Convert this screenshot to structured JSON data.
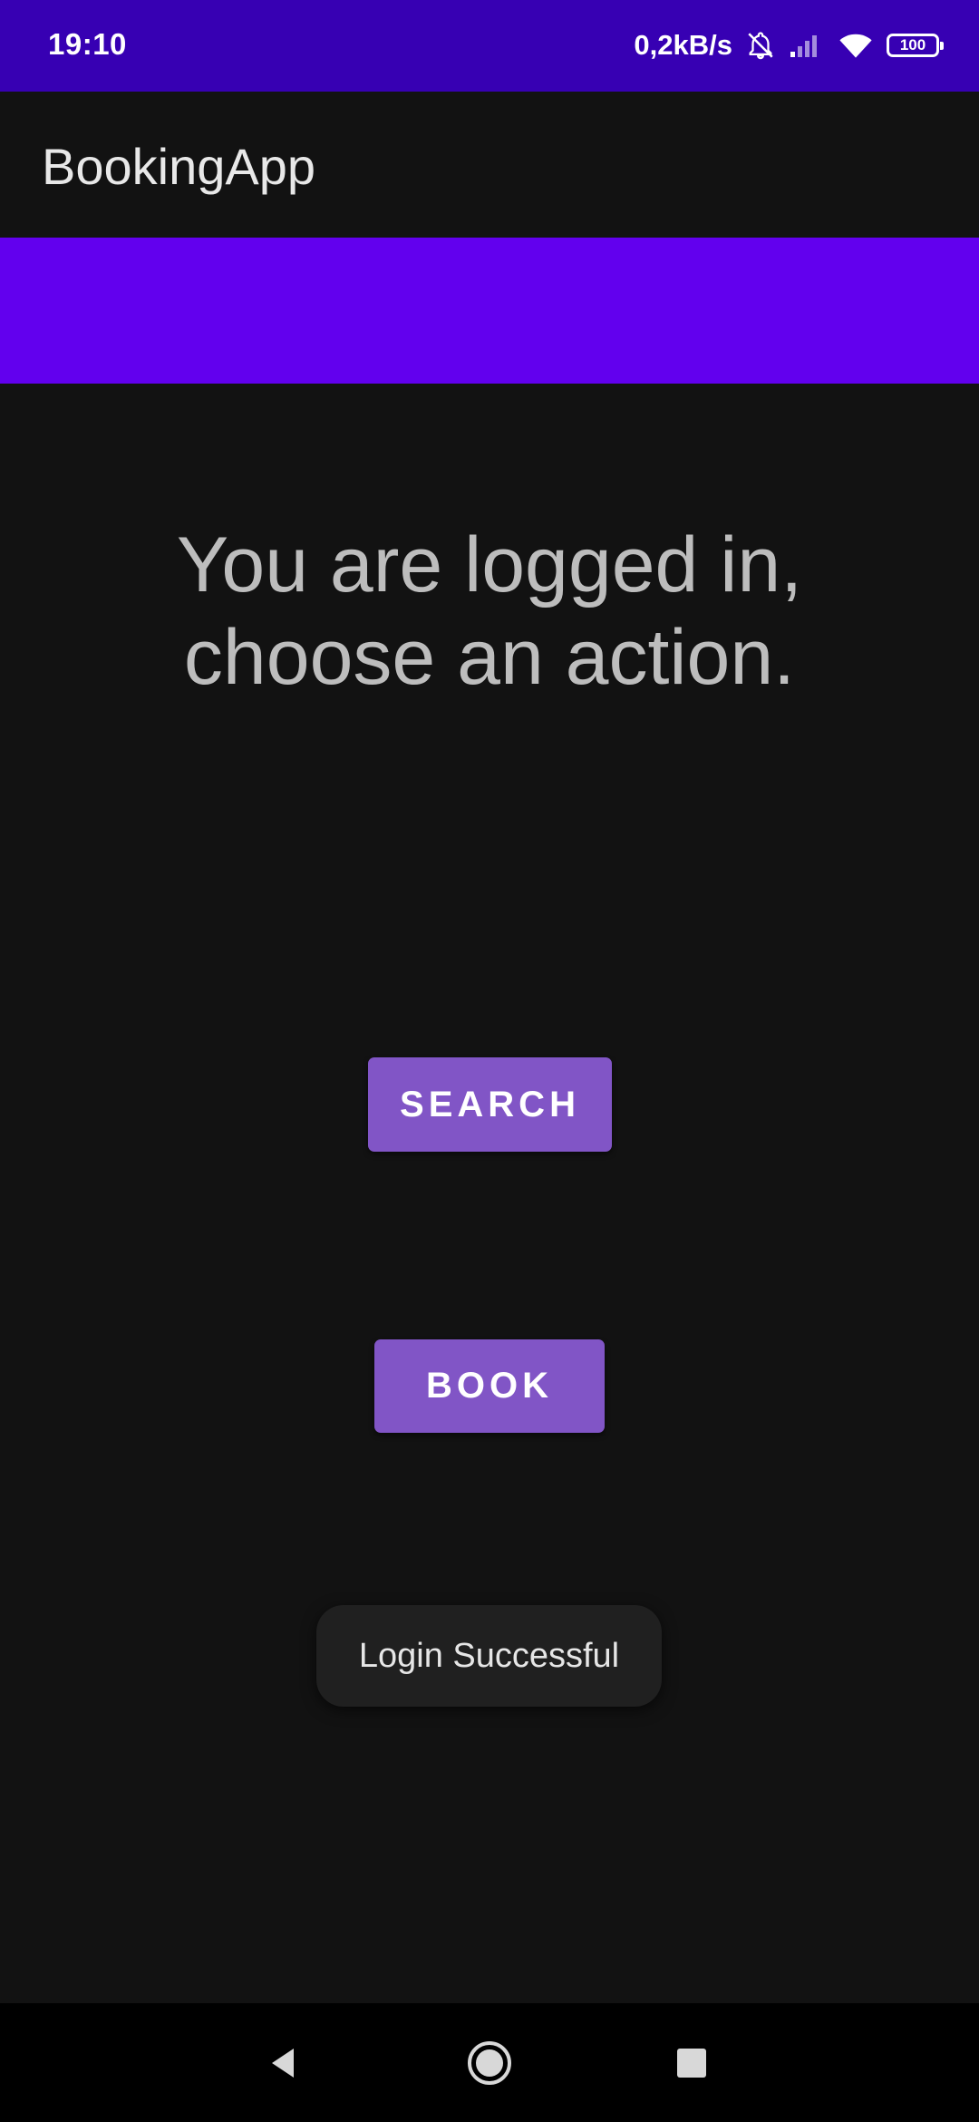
{
  "status_bar": {
    "time": "19:10",
    "net_speed": "0,2kB/s",
    "battery": "100",
    "icons": [
      "mute-icon",
      "signal-icon",
      "wifi-icon",
      "battery-icon"
    ]
  },
  "app_bar": {
    "title": "BookingApp"
  },
  "main": {
    "heading_line1": "You are logged in,",
    "heading_line2": "choose an action.",
    "search_label": "SEARCH",
    "book_label": "BOOK"
  },
  "toast": {
    "message": "Login Successful"
  },
  "nav_bar": {
    "icons": [
      "back-icon",
      "home-icon",
      "recents-icon"
    ]
  },
  "colors": {
    "status_bar": "#3700b3",
    "accent_band": "#6200ee",
    "button": "#8155c6",
    "background": "#121212"
  }
}
